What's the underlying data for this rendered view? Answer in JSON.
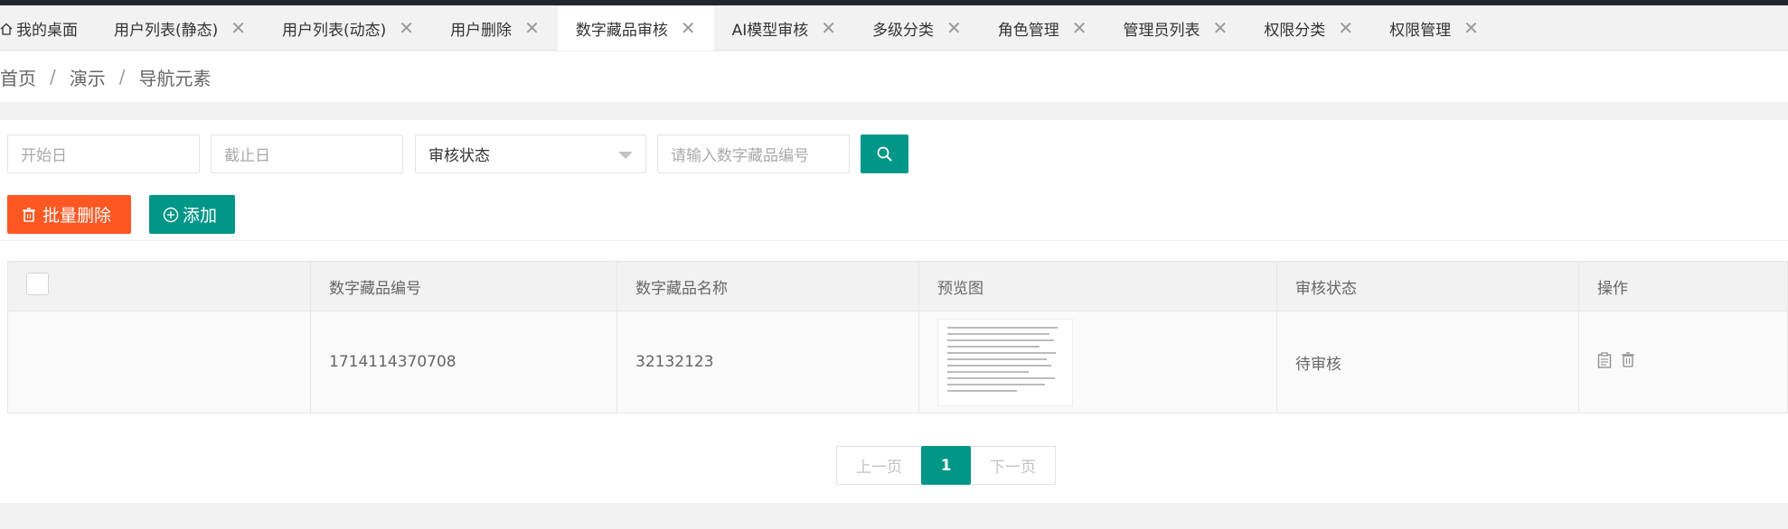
{
  "tabs": [
    {
      "label": "我的桌面",
      "home": true,
      "active": false
    },
    {
      "label": "用户列表(静态)",
      "active": false
    },
    {
      "label": "用户列表(动态)",
      "active": false
    },
    {
      "label": "用户删除",
      "active": false
    },
    {
      "label": "数字藏品审核",
      "active": true
    },
    {
      "label": "AI模型审核",
      "active": false
    },
    {
      "label": "多级分类",
      "active": false
    },
    {
      "label": "角色管理",
      "active": false
    },
    {
      "label": "管理员列表",
      "active": false
    },
    {
      "label": "权限分类",
      "active": false
    },
    {
      "label": "权限管理",
      "active": false
    }
  ],
  "tab_close_glyph": "✕",
  "breadcrumb": {
    "home": "首页",
    "sep": "/",
    "level2": "演示",
    "current": "导航元素"
  },
  "filters": {
    "start_placeholder": "开始日",
    "end_placeholder": "截止日",
    "status_select": "审核状态",
    "code_placeholder": "请输入数字藏品编号"
  },
  "buttons": {
    "batch_delete": "批量删除",
    "add": "添加"
  },
  "table": {
    "headers": [
      "数字藏品编号",
      "数字藏品名称",
      "预览图",
      "审核状态",
      "操作"
    ],
    "rows": [
      {
        "code": "1714114370708",
        "name": "32132123",
        "status": "待审核"
      }
    ]
  },
  "pager": {
    "prev": "上一页",
    "current": "1",
    "next": "下一页"
  },
  "colors": {
    "primary": "#009688",
    "danger": "#ff5722"
  }
}
